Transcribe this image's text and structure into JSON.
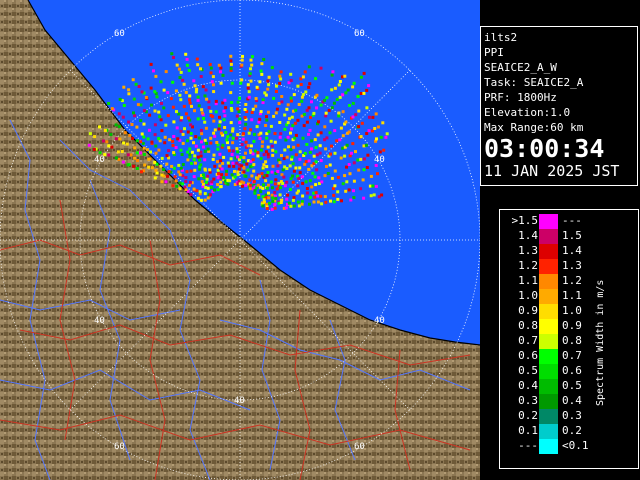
{
  "radar": {
    "site": "ilts2",
    "product": "PPI",
    "scan_name": "SEAICE2_A_W",
    "task": "Task: SEAICE2_A",
    "prf": "PRF: 1800Hz",
    "elevation": "Elevation:1.0",
    "max_range": "Max Range:60 km",
    "time": "03:00:34",
    "date": "11 JAN 2025 JST"
  },
  "range_ring_labels": [
    "60",
    "60",
    "40",
    "40",
    "40",
    "40",
    "60",
    "60"
  ],
  "legend": {
    "title": "Spectrum Width in m/s",
    "rows": [
      {
        "lo": ">1.5",
        "hi": "---",
        "color": "#ff00ff"
      },
      {
        "lo": "1.4",
        "hi": "1.5",
        "color": "#cc0066"
      },
      {
        "lo": "1.3",
        "hi": "1.4",
        "color": "#dd0000"
      },
      {
        "lo": "1.2",
        "hi": "1.3",
        "color": "#ff2200"
      },
      {
        "lo": "1.1",
        "hi": "1.2",
        "color": "#ff8800"
      },
      {
        "lo": "1.0",
        "hi": "1.1",
        "color": "#ffaa00"
      },
      {
        "lo": "0.9",
        "hi": "1.0",
        "color": "#ffdd00"
      },
      {
        "lo": "0.8",
        "hi": "0.9",
        "color": "#ffff00"
      },
      {
        "lo": "0.7",
        "hi": "0.8",
        "color": "#ccff00"
      },
      {
        "lo": "0.6",
        "hi": "0.7",
        "color": "#00ff00"
      },
      {
        "lo": "0.5",
        "hi": "0.6",
        "color": "#00dd00"
      },
      {
        "lo": "0.4",
        "hi": "0.5",
        "color": "#00bb00"
      },
      {
        "lo": "0.3",
        "hi": "0.4",
        "color": "#009900"
      },
      {
        "lo": "0.2",
        "hi": "0.3",
        "color": "#008866"
      },
      {
        "lo": "0.1",
        "hi": "0.2",
        "color": "#00cccc"
      },
      {
        "lo": "---",
        "hi": "<0.1",
        "color": "#00ffff"
      }
    ]
  },
  "colors": {
    "sea": "#1a5cff",
    "land_light": "#9a8562",
    "land_dark": "#6a5535",
    "rivers": "#5577ff",
    "roads": "#cc3322",
    "rings": "#ffffff"
  }
}
